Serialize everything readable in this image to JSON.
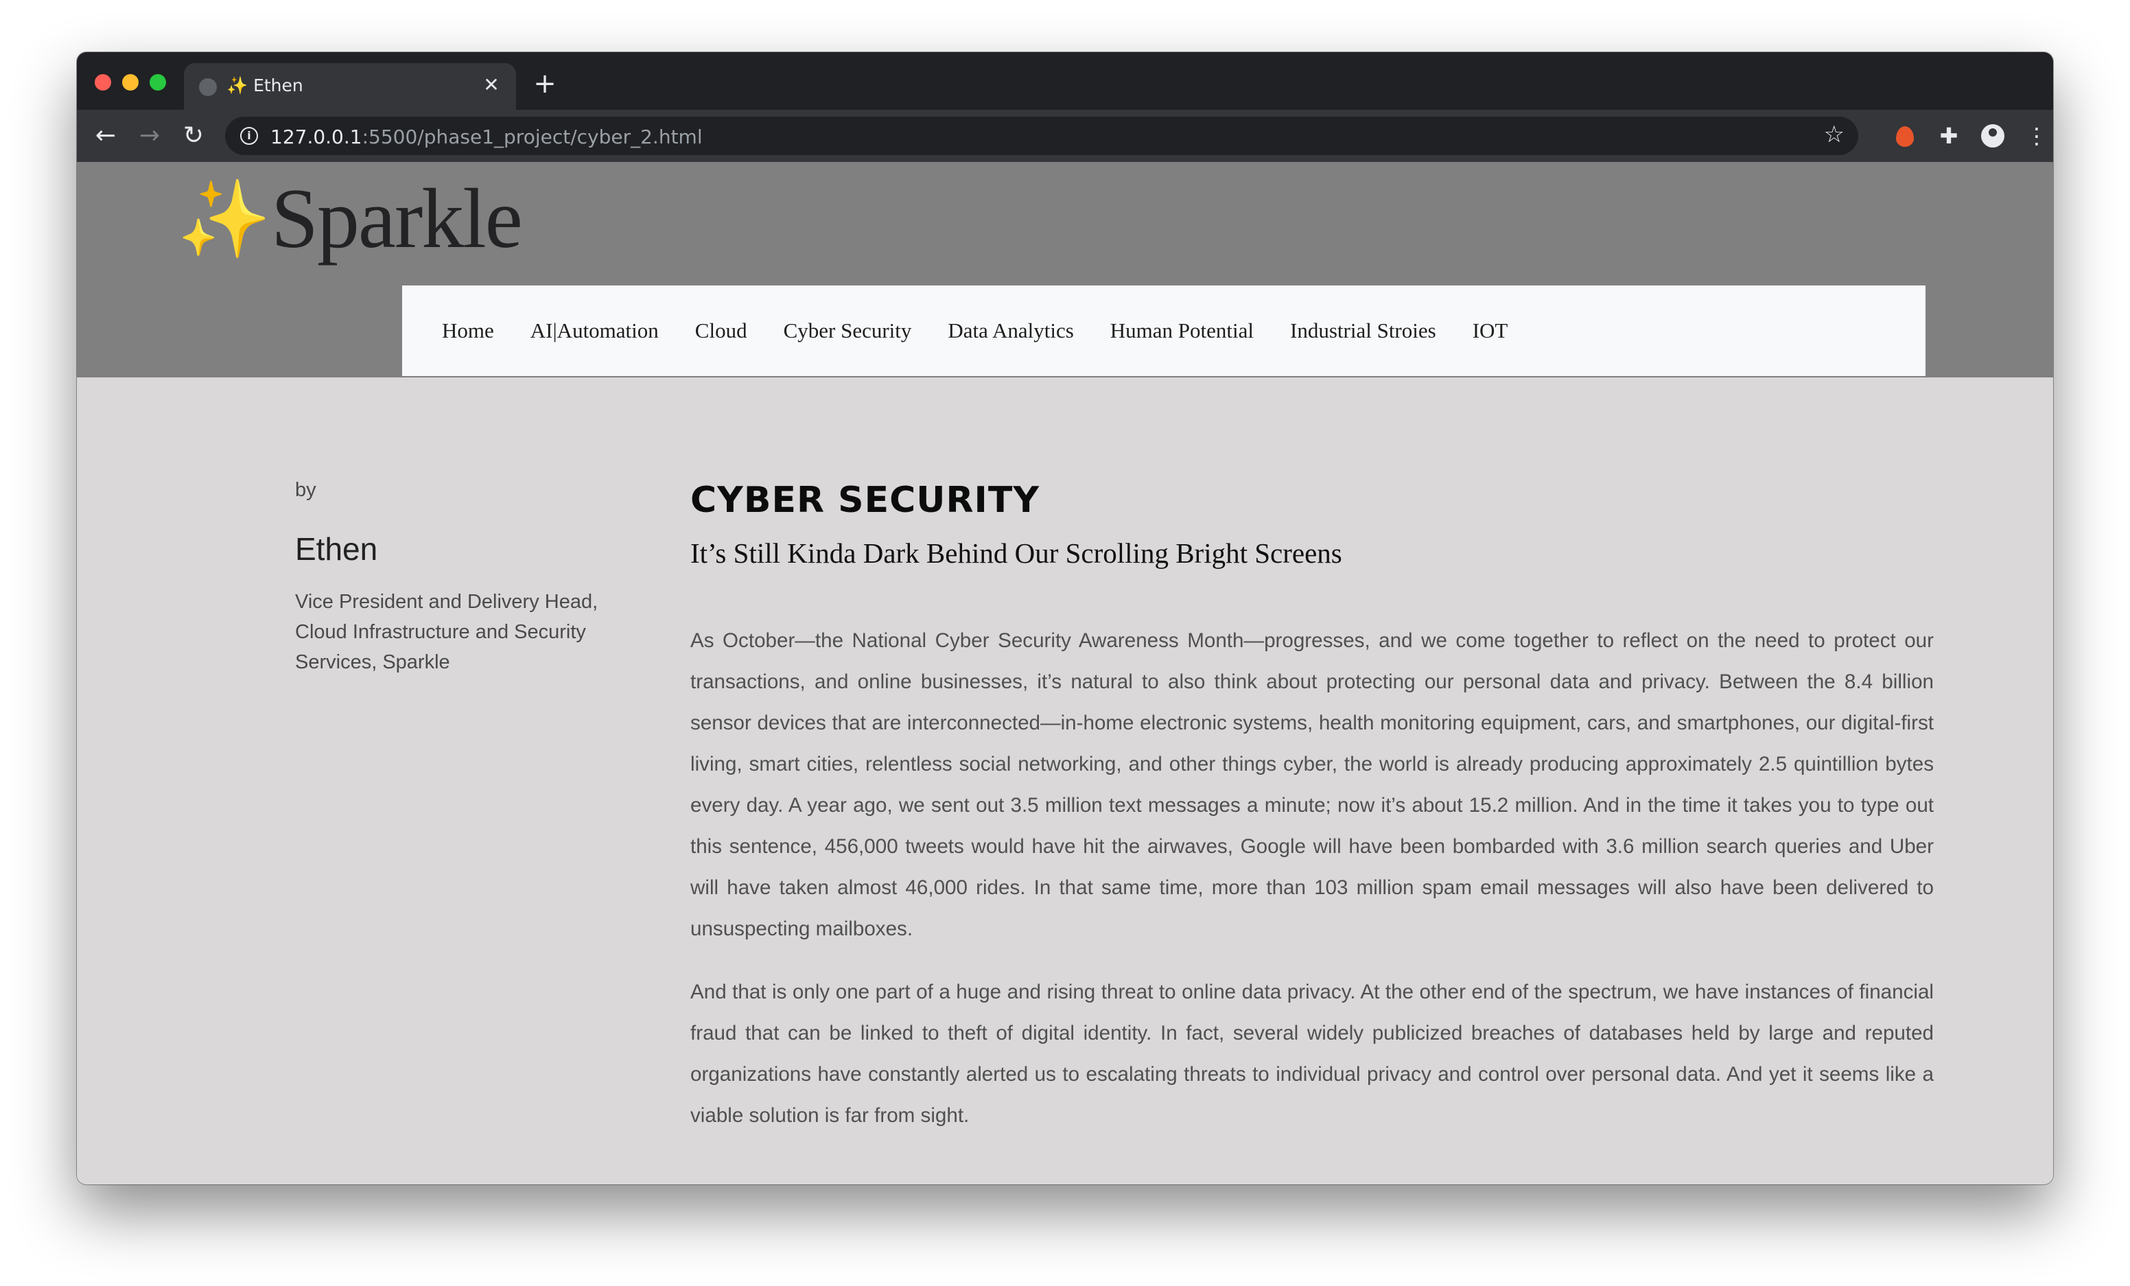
{
  "browser": {
    "tab_title": "✨ Ethen",
    "close_label": "✕",
    "new_tab_label": "+",
    "url_host": "127.0.0.1",
    "url_path": ":5500/phase1_project/cyber_2.html",
    "back_icon": "←",
    "forward_icon": "→",
    "reload_icon": "↻",
    "info_icon": "i",
    "star_icon": "☆",
    "puzzle_icon": "✚",
    "menu_icon": "⋮"
  },
  "site": {
    "logo_spark": "✨",
    "logo_text": "Sparkle"
  },
  "nav": {
    "items": [
      "Home",
      "AI|Automation",
      "Cloud",
      "Cyber Security",
      "Data Analytics",
      "Human Potential",
      "Industrial Stroies",
      "IOT"
    ]
  },
  "author": {
    "by": "by",
    "name": "Ethen",
    "role": "Vice President and Delivery Head, Cloud Infrastructure and Security Services, Sparkle"
  },
  "article": {
    "title": "CYBER SECURITY",
    "subtitle": "It’s Still Kinda Dark Behind Our Scrolling Bright Screens",
    "paragraphs": [
      "As October—the National Cyber Security Awareness Month—progresses, and we come together to reflect on the need to protect our transactions, and online businesses, it’s natural to also think about protecting our personal data and privacy. Between the 8.4 billion sensor devices that are interconnected—in-home electronic systems, health monitoring equipment, cars, and smartphones, our digital-first living, smart cities, relentless social networking, and other things cyber, the world is already producing approximately 2.5 quintillion bytes every day. A year ago, we sent out 3.5 million text messages a minute; now it’s about 15.2 million. And in the time it takes you to type out this sentence, 456,000 tweets would have hit the airwaves, Google will have been bombarded with 3.6 million search queries and Uber will have taken almost 46,000 rides. In that same time, more than 103 million spam email messages will also have been delivered to unsuspecting mailboxes.",
      "And that is only one part of a huge and rising threat to online data privacy. At the other end of the spectrum, we have instances of financial fraud that can be linked to theft of digital identity. In fact, several widely publicized breaches of databases held by large and reputed organizations have constantly alerted us to escalating threats to individual privacy and control over personal data. And yet it seems like a viable solution is far from sight."
    ]
  }
}
